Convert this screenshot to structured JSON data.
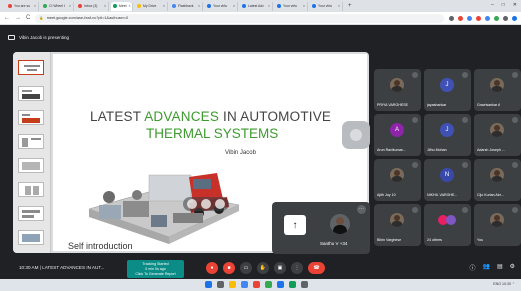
{
  "browser": {
    "tabs": [
      {
        "label": "You are su",
        "color": "#ea4335"
      },
      {
        "label": "CI Wheel t",
        "color": "#34a853"
      },
      {
        "label": "Inbox (3)",
        "color": "#ea4335"
      },
      {
        "label": "Meet",
        "color": "#0f9d58",
        "active": true
      },
      {
        "label": "My Drive",
        "color": "#fbbc04"
      },
      {
        "label": "Flashback",
        "color": "#4285f4"
      },
      {
        "label": "Your virtu",
        "color": "#1a73e8"
      },
      {
        "label": "Latest Adv",
        "color": "#1a73e8"
      },
      {
        "label": "Your virtu",
        "color": "#1a73e8"
      },
      {
        "label": "Your virtu",
        "color": "#1a73e8"
      }
    ],
    "new_tab": "+",
    "window_controls": [
      "–",
      "□",
      "✕"
    ],
    "nav": {
      "back": "←",
      "forward": "→",
      "reload": "C"
    },
    "url": "meet.google.com/ase-fxwf-nc?pli=1&authuser=0",
    "lock": "🔒",
    "extension_colors": [
      "#5f6368",
      "#ea4335",
      "#4285f4",
      "#ea4335",
      "#4285f4",
      "#34a853",
      "#5f6368",
      "#1a73e8"
    ]
  },
  "meet": {
    "presenting_text": "Vibin Jacob is presenting",
    "slide": {
      "title_part1": "LATEST ",
      "title_highlight": "ADVANCES",
      "title_part2": " IN AUTOMOTIVE",
      "title_line2": "THERMAL SYSTEMS",
      "author": "Vibin Jacob",
      "next_heading": "Self introduction"
    },
    "self_tile": {
      "present_icon": "↑",
      "name": "Santhu V +34",
      "more_icon": "⋯"
    },
    "participants": [
      {
        "name": "PRIYA VARGHESE",
        "type": "photo"
      },
      {
        "name": "jayashankar",
        "initial": "J",
        "color": "#3f51b5"
      },
      {
        "name": "Gowrisankar A",
        "type": "photo"
      },
      {
        "name": "Arun Ravikumar...",
        "initial": "A",
        "color": "#8e24aa"
      },
      {
        "name": "Jithu Mohan",
        "initial": "J",
        "color": "#3f51b5"
      },
      {
        "name": "Adarsh Joseph ...",
        "type": "photo"
      },
      {
        "name": "Ajith Joy 10",
        "type": "photo"
      },
      {
        "name": "NIKHIL VARGHE...",
        "initial": "N",
        "color": "#3949ab"
      },
      {
        "name": "Cijo Kurian Abr...",
        "type": "photo"
      },
      {
        "name": "Bibin Varghese",
        "type": "photo"
      },
      {
        "name": "24 others",
        "type": "others"
      },
      {
        "name": "You",
        "type": "photo"
      }
    ]
  },
  "toolbar": {
    "time_title": "10:30 AM | LATEST ADVANCES IN AUT...",
    "tracking_line1": "Tracking Started",
    "tracking_line2": "0 min 0s ago",
    "tracking_line3": "Click To Generate Report",
    "controls": [
      "mic-off",
      "cam-off",
      "captions",
      "raise-hand",
      "present",
      "more",
      "end-call"
    ],
    "right_icons": [
      "ⓘ",
      "👥",
      "▤",
      "⚙"
    ]
  },
  "taskbar": {
    "app_colors": [
      "#1a73e8",
      "#5f6368",
      "#fbbc04",
      "#4285f4",
      "#ea4335",
      "#34a853",
      "#1a73e8",
      "#0f9d58",
      "#5f6368"
    ],
    "right_text": "ENG  10:30  ⌃"
  }
}
